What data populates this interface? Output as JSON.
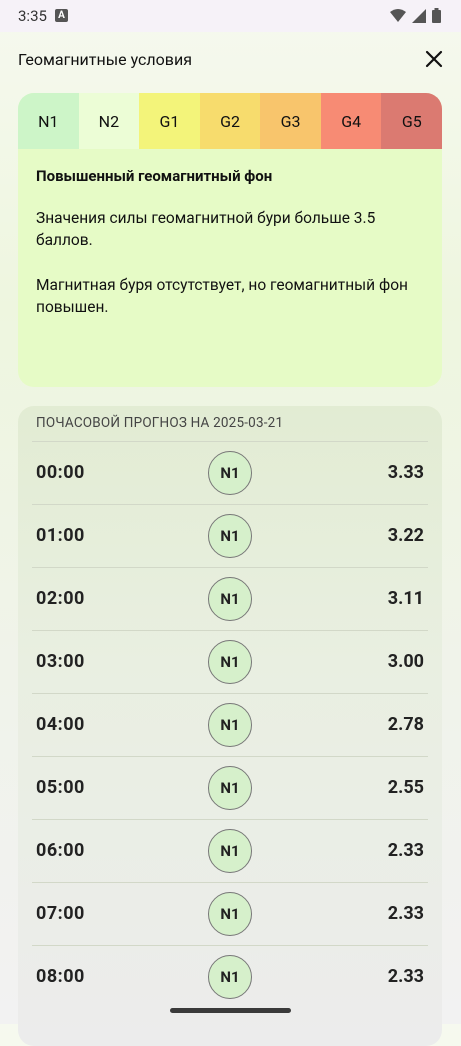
{
  "status": {
    "time": "3:35",
    "badge_letter": "A"
  },
  "header": {
    "title": "Геомагнитные условия"
  },
  "levels": [
    {
      "label": "N1",
      "color": "#cdf5c8"
    },
    {
      "label": "N2",
      "color": "#ecfdd6"
    },
    {
      "label": "G1",
      "color": "#f3f47a"
    },
    {
      "label": "G2",
      "color": "#f7dc6d"
    },
    {
      "label": "G3",
      "color": "#f8c56c"
    },
    {
      "label": "G4",
      "color": "#f78b74"
    },
    {
      "label": "G5",
      "color": "#db7a71"
    }
  ],
  "selected_level": "N2",
  "description": {
    "heading": "Повышенный геомагнитный фон",
    "text1": "Значения силы геомагнитной бури больше 3.5 баллов.",
    "text2": "Магнитная буря отсутствует, но геомагнитный фон повышен."
  },
  "forecast": {
    "caption": "ПОЧАСОВОЙ ПРОГНОЗ НА 2025-03-21",
    "rows": [
      {
        "hour": "00:00",
        "level": "N1",
        "value": "3.33"
      },
      {
        "hour": "01:00",
        "level": "N1",
        "value": "3.22"
      },
      {
        "hour": "02:00",
        "level": "N1",
        "value": "3.11"
      },
      {
        "hour": "03:00",
        "level": "N1",
        "value": "3.00"
      },
      {
        "hour": "04:00",
        "level": "N1",
        "value": "2.78"
      },
      {
        "hour": "05:00",
        "level": "N1",
        "value": "2.55"
      },
      {
        "hour": "06:00",
        "level": "N1",
        "value": "2.33"
      },
      {
        "hour": "07:00",
        "level": "N1",
        "value": "2.33"
      },
      {
        "hour": "08:00",
        "level": "N1",
        "value": "2.33"
      }
    ]
  }
}
